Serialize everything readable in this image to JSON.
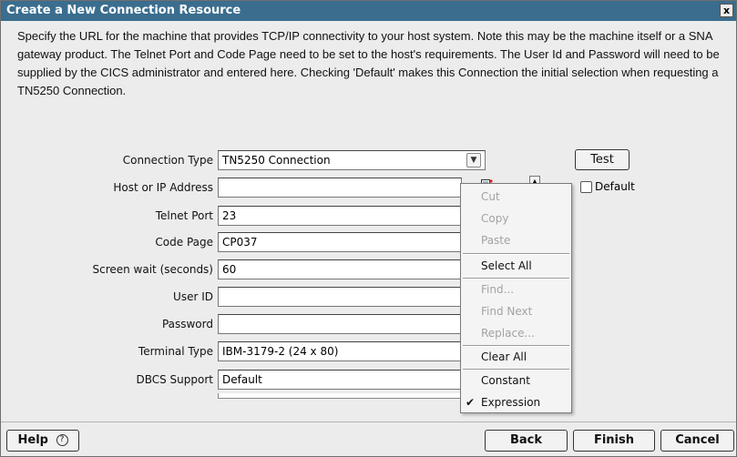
{
  "window": {
    "title": "Create a New Connection Resource",
    "close_label": "x"
  },
  "description": "Specify the URL for the machine that provides TCP/IP connectivity to your host system.  Note this may be the machine itself or a SNA gateway product. The Telnet Port and Code Page need to be set to the host's requirements. The User Id and Password will need to be supplied by the CICS administrator and entered here. Checking 'Default' makes this Connection the initial selection when requesting a TN5250 Connection.",
  "form": {
    "connection_type": {
      "label": "Connection Type",
      "value": "TN5250 Connection"
    },
    "host": {
      "label": "Host or IP Address",
      "value": ""
    },
    "telnet_port": {
      "label": "Telnet Port",
      "value": "23"
    },
    "code_page": {
      "label": "Code Page",
      "value": "CP037"
    },
    "screen_wait": {
      "label": "Screen wait (seconds)",
      "value": "60"
    },
    "user_id": {
      "label": "User ID",
      "value": ""
    },
    "password": {
      "label": "Password",
      "value": ""
    },
    "terminal_type": {
      "label": "Terminal Type",
      "value": "IBM-3179-2 (24 x 80)"
    },
    "dbcs_support": {
      "label": "DBCS Support",
      "value": "Default"
    },
    "test_button": "Test",
    "default_checkbox": "Default"
  },
  "context_menu": {
    "items": [
      {
        "label": "Cut",
        "enabled": false
      },
      {
        "label": "Copy",
        "enabled": false
      },
      {
        "label": "Paste",
        "enabled": false
      },
      {
        "label": "Select All",
        "enabled": true
      },
      {
        "label": "Find...",
        "enabled": false
      },
      {
        "label": "Find Next",
        "enabled": false
      },
      {
        "label": "Replace...",
        "enabled": false
      },
      {
        "label": "Clear All",
        "enabled": true
      },
      {
        "label": "Constant",
        "enabled": true
      },
      {
        "label": "Expression",
        "enabled": true,
        "checked": true
      }
    ]
  },
  "footer": {
    "help": "Help",
    "help_icon": "question-circle-icon",
    "back": "Back",
    "finish": "Finish",
    "cancel": "Cancel"
  },
  "colors": {
    "titlebar": "#3a6d8e",
    "background": "#ececec"
  }
}
